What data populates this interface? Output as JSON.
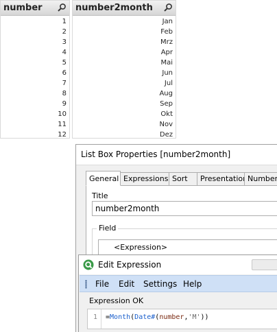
{
  "listbox_number": {
    "title": "number",
    "items": [
      "1",
      "2",
      "3",
      "4",
      "5",
      "6",
      "7",
      "8",
      "9",
      "10",
      "11",
      "12"
    ]
  },
  "listbox_month": {
    "title": "number2month",
    "items": [
      "Jan",
      "Feb",
      "Mrz",
      "Apr",
      "Mai",
      "Jun",
      "Jul",
      "Aug",
      "Sep",
      "Okt",
      "Nov",
      "Dez"
    ]
  },
  "properties": {
    "window_title": "List Box Properties [number2month]",
    "tabs": [
      "General",
      "Expressions",
      "Sort",
      "Presentation",
      "Number"
    ],
    "active_tab": "General",
    "title_label": "Title",
    "title_value": "number2month",
    "field_label": "Field",
    "field_value": "<Expression>"
  },
  "edit_expression": {
    "window_title": "Edit Expression",
    "menu": [
      "File",
      "Edit",
      "Settings",
      "Help"
    ],
    "status": "Expression OK",
    "line_number": "1",
    "code_tokens": [
      "=",
      "Month",
      "(",
      "Date#",
      "(",
      "number",
      ",",
      "'M'",
      "))"
    ]
  },
  "colors": {
    "menubar": "#cfe0f6",
    "function_token": "#1a5fcc",
    "field_token": "#7a2a12",
    "app_icon_green": "#3a9a48"
  },
  "icons": {
    "listbox_search": "magnifier-icon",
    "app": "qlikview-app-icon"
  }
}
